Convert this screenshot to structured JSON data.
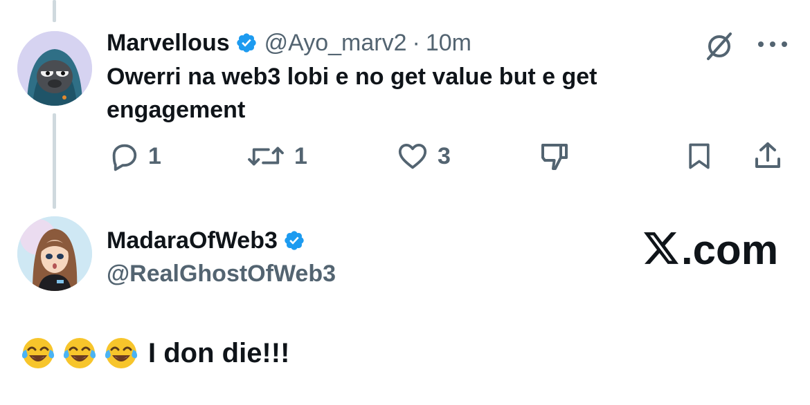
{
  "tweet": {
    "display_name": "Marvellous",
    "handle": "@Ayo_marv2",
    "separator": "·",
    "time": "10m",
    "text": "Owerri na web3 lobi e no get value but e get engagement",
    "actions": {
      "reply_count": "1",
      "retweet_count": "1",
      "like_count": "3"
    }
  },
  "quoted_user": {
    "display_name": "MadaraOfWeb3",
    "handle": "@RealGhostOfWeb3"
  },
  "brand": {
    "domain_suffix": ".com"
  },
  "reply": {
    "emojis": [
      "face-with-tears-of-joy",
      "face-with-tears-of-joy",
      "face-with-tears-of-joy"
    ],
    "text": "I don die!!!"
  },
  "icons": {
    "reply": "speech-bubble-icon",
    "retweet": "retweet-icon",
    "like": "heart-icon",
    "dislike": "thumbs-down-icon",
    "bookmark": "bookmark-icon",
    "share": "share-icon",
    "grok": "grok-icon",
    "more": "more-dots-icon",
    "verified": "verified-badge-icon"
  },
  "colors": {
    "text_primary": "#0f1419",
    "text_secondary": "#536471",
    "verified_blue": "#1d9bf0",
    "thread_line": "#cfd9de"
  }
}
